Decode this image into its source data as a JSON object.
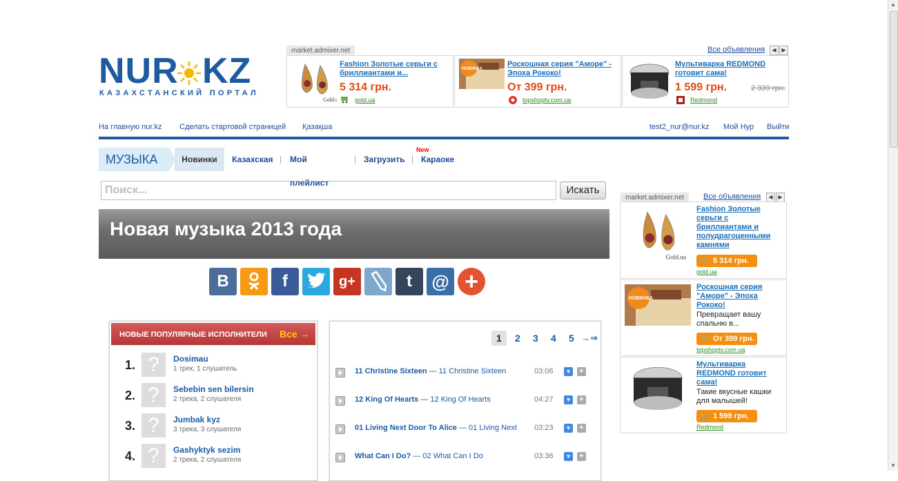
{
  "logo": {
    "left_word": "NUR",
    "right_word": "KZ",
    "tagline": "КАЗАХСТАНСКИЙ ПОРТАЛ"
  },
  "top_ad": {
    "source": "market.admixer.net",
    "all_link": "Все объявления",
    "items": [
      {
        "title": "Fashion Золотые серьги с бриллиантами и...",
        "price": "5 314 грн.",
        "old_price": "",
        "source": "gold.ua"
      },
      {
        "title": "Роскошная серия \"Аморе\" - Эпоха Рококо!",
        "price": "От 399 грн.",
        "old_price": "",
        "source": "topshoptv.com.ua"
      },
      {
        "title": "Мультиварка REDMOND готовит сама!",
        "price": "1 599 грн.",
        "old_price": "2 339 грн.",
        "source": "Redmond"
      }
    ]
  },
  "topnav": {
    "home": "На главную nur.kz",
    "start_page": "Сделать стартовой страницей",
    "kazakh": "Қазақша",
    "email": "test2_nur@nur.kz",
    "my_nur": "Мой Нур",
    "logout": "Выйти"
  },
  "section": {
    "title": "МУЗЫКА",
    "tabs": [
      "Новинки",
      "Казахская",
      "Мой плейлист",
      "Загрузить",
      "Караоке"
    ],
    "new_badge": "New"
  },
  "search": {
    "placeholder": "Поиск...",
    "button": "Искать"
  },
  "banner": {
    "title": "Новая музыка 2013 года"
  },
  "share_icons": [
    "vk-icon",
    "odnoklassniki-icon",
    "facebook-icon",
    "twitter-icon",
    "googleplus-icon",
    "livejournal-icon",
    "tumblr-icon",
    "mailru-icon",
    "more-icon"
  ],
  "artists": {
    "header": "НОВЫЕ ПОПУЛЯРНЫЕ ИСПОЛНИТЕЛИ",
    "all_link": "Все →",
    "items": [
      {
        "rank": "1.",
        "name": "Dosimau",
        "meta": "1 трек, 1 слушатель"
      },
      {
        "rank": "2.",
        "name": "Sebebin sen bilersin",
        "meta": "2 трека, 2 слушателя"
      },
      {
        "rank": "3.",
        "name": "Jumbak kyz",
        "meta": "3 трека, 3 слушателя"
      },
      {
        "rank": "4.",
        "name": "Gashyktyk sezim",
        "meta": "2 трека, 2 слушателя"
      }
    ]
  },
  "tracks": {
    "pages": [
      "1",
      "2",
      "3",
      "4",
      "5"
    ],
    "next": "→⇒",
    "items": [
      {
        "title": "11 Christine Sixteen",
        "album": "— 11 Christine Sixteen",
        "duration": "03:06"
      },
      {
        "title": "12 King Of Hearts",
        "album": "— 12 King Of Hearts",
        "duration": "04:27"
      },
      {
        "title": "01 Living Next Door To Alice",
        "album": "— 01 Living Next",
        "duration": "03:23"
      },
      {
        "title": "What Can I Do?",
        "album": "— 02 What Can I Do",
        "duration": "03:36"
      }
    ]
  },
  "right_ad": {
    "source": "market.admixer.net",
    "all_link": "Все объявления",
    "items": [
      {
        "title": "Fashion Золотые серьги с бриллиантами и полудрагоценными камнями",
        "desc": "",
        "price": "5 314 грн.",
        "source": "gold.ua"
      },
      {
        "title": "Роскошная серия \"Аморе\" - Эпоха Рококо!",
        "desc": "Превращает вашу спальню в...",
        "price": "От 399 грн.",
        "source": "topshoptv.com.ua"
      },
      {
        "title": "Мультиварка REDMOND готовит сама!",
        "desc": "Такие вкусные кашки для малышей!",
        "price": "1 599 грн.",
        "source": "Redmond"
      }
    ]
  },
  "colors": {
    "brand_blue": "#1d5aa0",
    "price_orange": "#e04a12",
    "header_red": "#b73535",
    "button_orange": "#f58f12"
  }
}
